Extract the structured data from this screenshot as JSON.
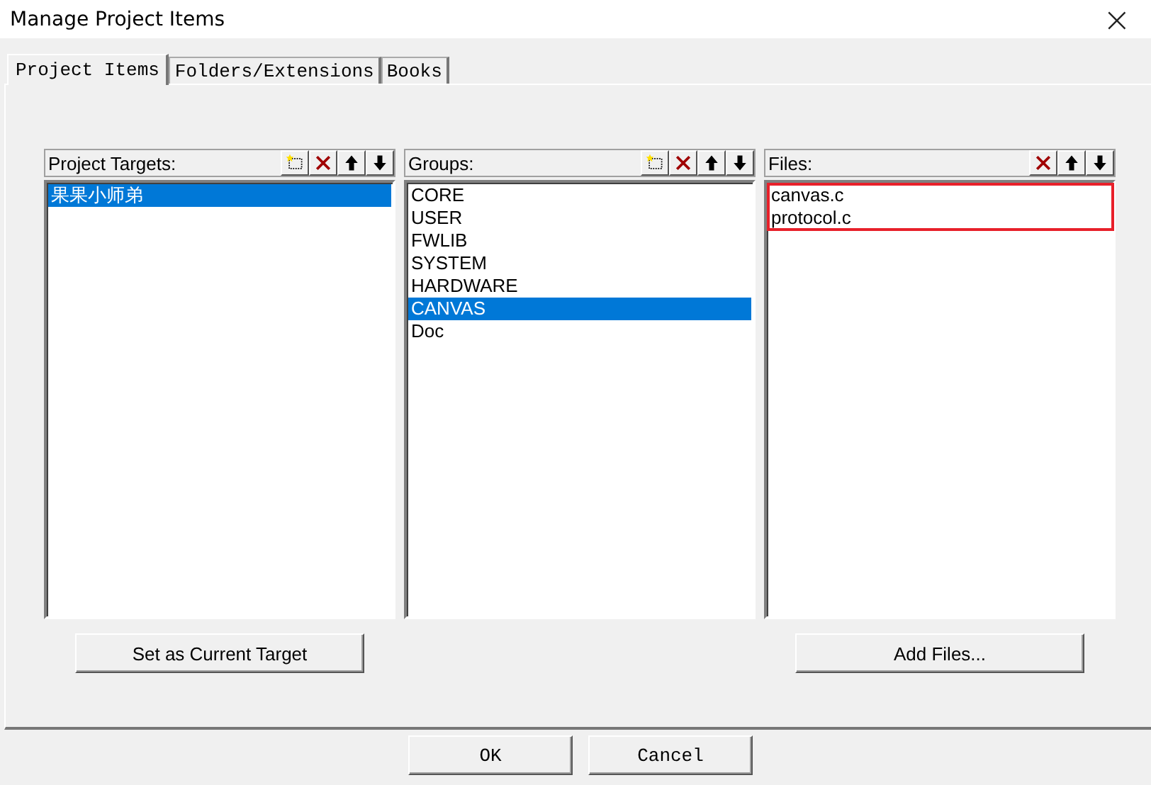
{
  "window": {
    "title": "Manage Project Items",
    "close": "×"
  },
  "tabs": [
    {
      "label": "Project Items",
      "selected": true
    },
    {
      "label": "Folders/Extensions",
      "selected": false
    },
    {
      "label": "Books",
      "selected": false
    }
  ],
  "panes": [
    {
      "header": "Project Targets:",
      "tools": [
        {
          "kind": "new"
        },
        {
          "kind": "delete"
        },
        {
          "kind": "up"
        },
        {
          "kind": "down"
        }
      ],
      "items": [
        {
          "label": "果果小师弟",
          "selected": true
        }
      ],
      "highlighted": false,
      "button": "Set as Current Target"
    },
    {
      "header": "Groups:",
      "tools": [
        {
          "kind": "new"
        },
        {
          "kind": "delete"
        },
        {
          "kind": "up"
        },
        {
          "kind": "down"
        }
      ],
      "items": [
        {
          "label": "CORE",
          "selected": false
        },
        {
          "label": "USER",
          "selected": false
        },
        {
          "label": "FWLIB",
          "selected": false
        },
        {
          "label": "SYSTEM",
          "selected": false
        },
        {
          "label": "HARDWARE",
          "selected": false
        },
        {
          "label": "CANVAS",
          "selected": true
        },
        {
          "label": "Doc",
          "selected": false
        }
      ],
      "highlighted": false
    },
    {
      "header": "Files:",
      "tools": [
        {
          "kind": "delete"
        },
        {
          "kind": "up"
        },
        {
          "kind": "down"
        }
      ],
      "items": [
        {
          "label": "canvas.c",
          "selected": false
        },
        {
          "label": "protocol.c",
          "selected": false
        }
      ],
      "highlighted": true,
      "button": "Add Files..."
    }
  ],
  "buttons": [
    "OK",
    "Cancel"
  ]
}
